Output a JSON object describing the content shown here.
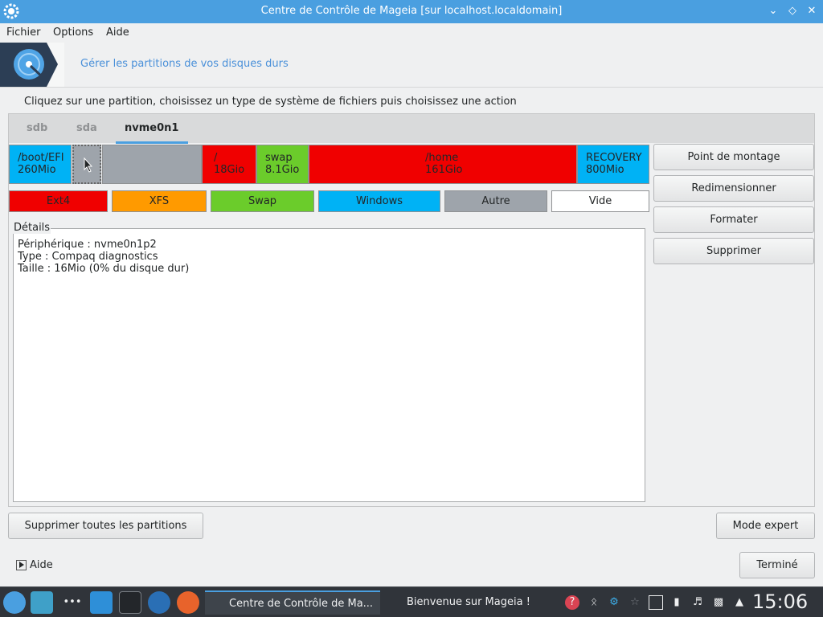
{
  "window": {
    "title": "Centre de Contrôle de Mageia [sur localhost.localdomain]"
  },
  "menu": [
    "Fichier",
    "Options",
    "Aide"
  ],
  "banner": {
    "heading": "Gérer les partitions de vos disques durs"
  },
  "instruction": "Cliquez sur une partition, choisissez un type de système de fichiers puis choisissez une action",
  "tabs": [
    "sdb",
    "sda",
    "nvme0n1"
  ],
  "partitions": [
    {
      "name": "/boot/EFI",
      "size": "260Mio",
      "type": "Windows"
    },
    {
      "name": "",
      "size": "",
      "type": "Autre"
    },
    {
      "name": "",
      "size": "",
      "type": "Autre"
    },
    {
      "name": "/",
      "size": "18Gio",
      "type": "Ext4"
    },
    {
      "name": "swap",
      "size": "8.1Gio",
      "type": "Swap"
    },
    {
      "name": "/home",
      "size": "161Gio",
      "type": "Ext4"
    },
    {
      "name": "RECOVERY",
      "size": "800Mio",
      "type": "Windows"
    }
  ],
  "legend": [
    "Ext4",
    "XFS",
    "Swap",
    "Windows",
    "Autre",
    "Vide"
  ],
  "colors": {
    "ext4": "#f00000",
    "xfs": "#ff9a00",
    "swap": "#6bcc2b",
    "windows": "#00b2f5",
    "autre": "#9ea4ab",
    "vide": "#ffffff",
    "accent": "#4a9fe0"
  },
  "details": {
    "label": "Détails",
    "lines": [
      "Périphérique : nvme0n1p2",
      "Type : Compaq diagnostics",
      "Taille : 16Mio (0% du disque dur)"
    ]
  },
  "actions": [
    "Point de montage",
    "Redimensionner",
    "Formater",
    "Supprimer"
  ],
  "bottom": {
    "delete_all": "Supprimer toutes les partitions",
    "expert": "Mode expert",
    "help": "Aide",
    "done": "Terminé"
  },
  "taskbar": {
    "tasks": [
      "Centre de Contrôle de Ma...",
      "Bienvenue sur Mageia !"
    ],
    "clock": "15:06",
    "launcher_icons": [
      "application-menu-icon",
      "desktop-icon",
      "more-icon",
      "file-manager-icon",
      "settings-icon",
      "mageia-control-center-icon",
      "firefox-icon"
    ],
    "tray_icons": [
      "help-icon",
      "bluetooth-icon",
      "updates-icon",
      "network-icon",
      "battery-icon",
      "usb-icon",
      "volume-icon",
      "clipboard-icon",
      "expand-tray-icon"
    ]
  }
}
